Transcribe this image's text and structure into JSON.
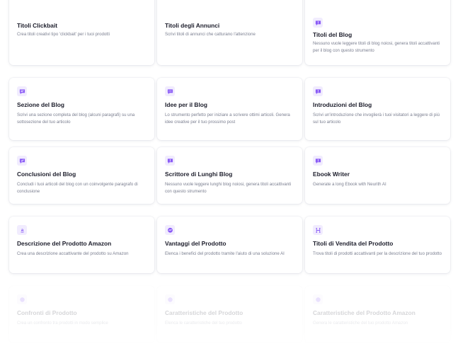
{
  "cards": [
    {
      "title": "Titoli Clickbait",
      "desc": "Crea titoli creativi tipo 'clickbait' per i tuoi prodotti",
      "icon": "none"
    },
    {
      "title": "Titoli degli Annunci",
      "desc": "Scrivi titoli di annunci che catturano l'attenzione",
      "icon": "none"
    },
    {
      "title": "Titoli del Blog",
      "desc": "Nessuno vuole leggere titoli di blog noiosi, genera titoli accattivanti per il blog con questo strumento",
      "icon": "chat-alert-icon"
    },
    {
      "title": "Sezione del Blog",
      "desc": "Scrivi una sezione completa del blog (alcuni paragrafi) su una sottosezione del tuo articolo",
      "icon": "chat-lines-icon"
    },
    {
      "title": "Idee per il Blog",
      "desc": "Lo strumento perfetto per iniziare a scrivere ottimi articoli. Genera idee creative per il tuo prossimo post",
      "icon": "chat-dots-icon"
    },
    {
      "title": "Introduzioni del Blog",
      "desc": "Scrivi un'introduzione che invoglierà i tuoi visitatori a leggere di più sul tuo articolo",
      "icon": "chat-alert-icon"
    },
    {
      "title": "Conclusioni del Blog",
      "desc": "Concludi i tuoi articoli del blog con un coinvolgente paragrafo di conclusione",
      "icon": "chat-check-icon"
    },
    {
      "title": "Scrittore di Lunghi Blog",
      "desc": "Nessuno vuole leggere lunghi blog noiosi, genera titoli accattivanti con questo strumento",
      "icon": "chat-alert-icon"
    },
    {
      "title": "Ebook Writer",
      "desc": "Generate a long Ebook with Neurith AI",
      "icon": "chat-alert-icon"
    },
    {
      "title": "Descrizione del Prodotto Amazon",
      "desc": "Crea una descrizione accattivante del prodotto su Amazon",
      "icon": "amazon-icon"
    },
    {
      "title": "Vantaggi del Prodotto",
      "desc": "Elenca i benefici del prodotto tramite l'aiuto di una soluzione AI",
      "icon": "messenger-icon"
    },
    {
      "title": "Titoli di Vendita del Prodotto",
      "desc": "Trova titoli di prodotti accattivanti per la descrizione del tuo prodotto",
      "icon": "h-icon"
    },
    {
      "title": "Confronti di Prodotto",
      "desc": "Crea un confronto tra prodotti in modo semplice",
      "icon": "circle-icon"
    },
    {
      "title": "Caratteristiche del Prodotto",
      "desc": "Elenca le caratteristiche del tuo prodotto",
      "icon": "circle-icon"
    },
    {
      "title": "Caratteristiche del Prodotto Amazon",
      "desc": "Genera le caratteristiche del tuo prodotto Amazon",
      "icon": "circle-icon"
    }
  ],
  "colors": {
    "accent": "#8b5cf6",
    "accent_bg": "#f1ecfe",
    "title": "#1c1d2b",
    "desc": "#7b7f90"
  }
}
